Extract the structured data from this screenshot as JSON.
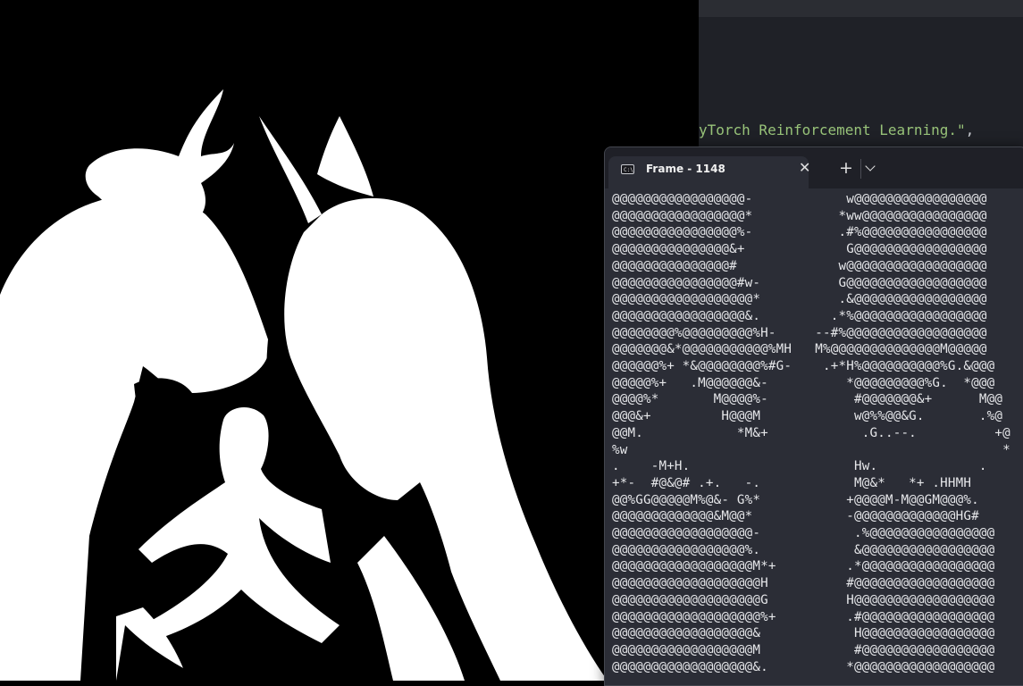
{
  "editor": {
    "code_text": "yTorch Reinforcement Learning.\"",
    "code_tail": ","
  },
  "terminal": {
    "tab_title": "Frame - 1148",
    "close_glyph": "✕",
    "new_tab_glyph": "+",
    "icon_text": "C:\\",
    "ascii_lines": [
      "@@@@@@@@@@@@@@@@@-            w@@@@@@@@@@@@@@@@@",
      "@@@@@@@@@@@@@@@@@*           *ww@@@@@@@@@@@@@@@@",
      "@@@@@@@@@@@@@@@@%-           .#%@@@@@@@@@@@@@@@@",
      "@@@@@@@@@@@@@@@&+             G@@@@@@@@@@@@@@@@@",
      "@@@@@@@@@@@@@@@#             w@@@@@@@@@@@@@@@@@@",
      "@@@@@@@@@@@@@@@@#w-          G@@@@@@@@@@@@@@@@@@",
      "@@@@@@@@@@@@@@@@@@*          .&@@@@@@@@@@@@@@@@@",
      "@@@@@@@@@@@@@@@@@&.         .*%@@@@@@@@@@@@@@@@@",
      "@@@@@@@@%@@@@@@@@@%H-     --#%@@@@@@@@@@@@@@@@@@",
      "@@@@@@@&*@@@@@@@@@@@%MH   M%@@@@@@@@@@@@@@M@@@@@",
      "@@@@@@%+ *&@@@@@@@@%#G-    .+*H%@@@@@@@@@@%G.&@@@",
      "@@@@@%+   .M@@@@@@&-          *@@@@@@@@@%G.  *@@@",
      "@@@@%*       M@@@@%-           #@@@@@@@&+      M@@",
      "@@@&+         H@@@M            w@%%@@&G.       .%@",
      "@@M.            *M&+            .G..--.          +@",
      "%w                                                *",
      ".    -M+H.                     Hw.             .",
      "+*-  #@&@# .+.   -.            M@&*   *+ .HHMH",
      "@@%GG@@@@@M%@&- G%*           +@@@@M-M@@GM@@@%.",
      "@@@@@@@@@@@@@&M@@*            -@@@@@@@@@@@@@HG#",
      "@@@@@@@@@@@@@@@@@@-            .%@@@@@@@@@@@@@@@@",
      "@@@@@@@@@@@@@@@@@%.            &@@@@@@@@@@@@@@@@@",
      "@@@@@@@@@@@@@@@@@@M*+         .*@@@@@@@@@@@@@@@@@",
      "@@@@@@@@@@@@@@@@@@@H          #@@@@@@@@@@@@@@@@@@",
      "@@@@@@@@@@@@@@@@@@@G          H@@@@@@@@@@@@@@@@@@",
      "@@@@@@@@@@@@@@@@@@@%+         .#@@@@@@@@@@@@@@@@@",
      "@@@@@@@@@@@@@@@@@@&            H@@@@@@@@@@@@@@@@@",
      "@@@@@@@@@@@@@@@@@@M            #@@@@@@@@@@@@@@@@@",
      "@@@@@@@@@@@@@@@@@@&.          *@@@@@@@@@@@@@@@@@@"
    ]
  },
  "colors": {
    "terminal_bg": "#2b2d36",
    "tabbar_bg": "#1f2027",
    "editor_bg": "#1f2127",
    "string_green": "#98c379"
  }
}
